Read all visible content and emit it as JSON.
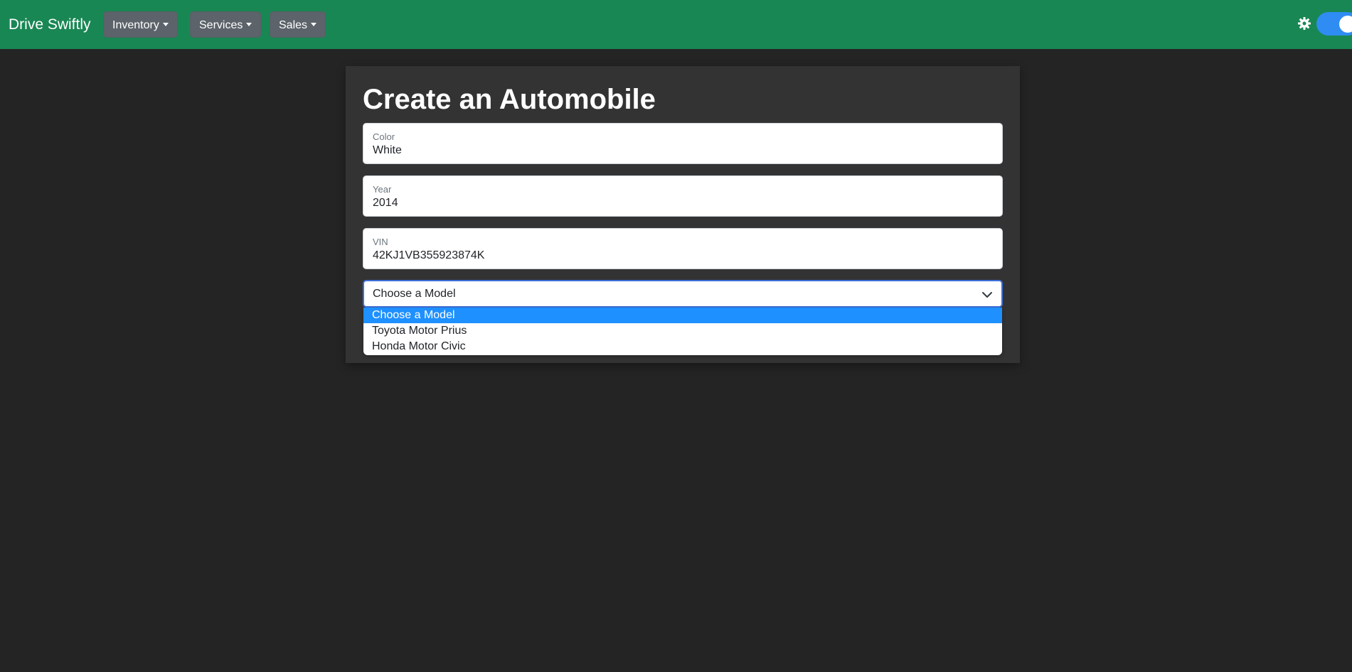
{
  "navbar": {
    "brand": "Drive Swiftly",
    "menus": [
      {
        "label": "Inventory"
      },
      {
        "label": "Services"
      },
      {
        "label": "Sales"
      }
    ],
    "theme_toggle": {
      "state": "on",
      "icon": "gear-icon"
    },
    "colors": {
      "background": "#198754",
      "toggle": "#2f8cf3"
    }
  },
  "form": {
    "title": "Create an Automobile",
    "fields": {
      "color": {
        "label": "Color",
        "value": "White"
      },
      "year": {
        "label": "Year",
        "value": "2014"
      },
      "vin": {
        "label": "VIN",
        "value": "42KJ1VB355923874K"
      }
    },
    "model_select": {
      "value": "Choose a Model",
      "options": [
        {
          "label": "Choose a Model",
          "selected": true
        },
        {
          "label": "Toyota Motor Prius",
          "selected": false
        },
        {
          "label": "Honda Motor Civic",
          "selected": false
        }
      ]
    }
  }
}
